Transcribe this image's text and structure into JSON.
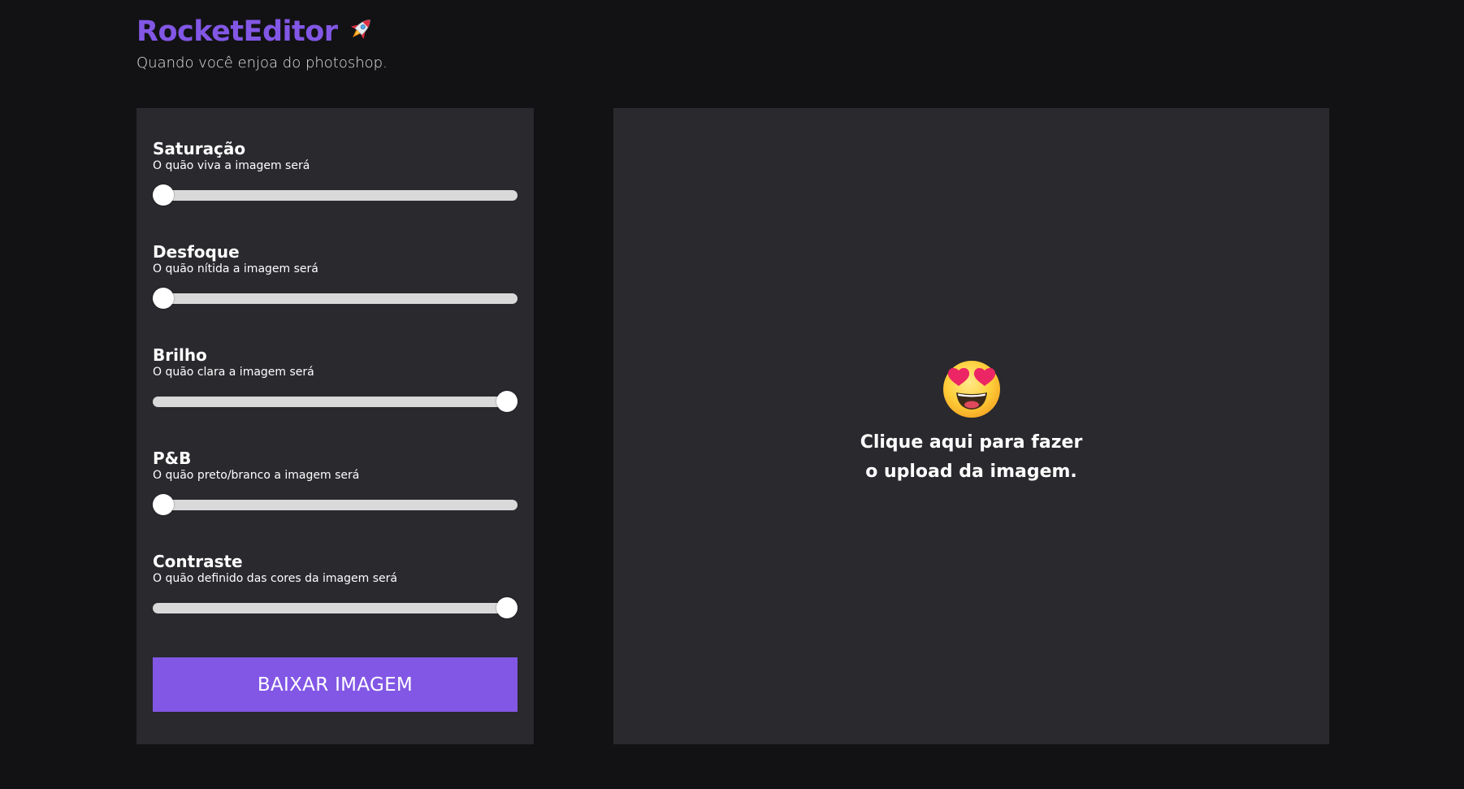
{
  "header": {
    "title": "RocketEditor",
    "subtitle": "Quando você enjoa do photoshop."
  },
  "controls": [
    {
      "key": "saturation",
      "label": "Saturação",
      "description": "O quão viva a imagem será",
      "value": 0
    },
    {
      "key": "blur",
      "label": "Desfoque",
      "description": "O quão nítida a imagem será",
      "value": 0
    },
    {
      "key": "brightness",
      "label": "Brilho",
      "description": "O quão clara a imagem será",
      "value": 1
    },
    {
      "key": "grayscale",
      "label": "P&B",
      "description": "O quão preto/branco a imagem será",
      "value": 0
    },
    {
      "key": "contrast",
      "label": "Contraste",
      "description": "O quão definido das cores da imagem será",
      "value": 1
    }
  ],
  "download_button": {
    "label": "BAIXAR IMAGEM"
  },
  "upload": {
    "text": "Clique aqui para fazer o upload da imagem.",
    "icon": "heart-eyes-emoji-icon"
  },
  "colors": {
    "accent": "#8257e5",
    "background": "#121214",
    "panel": "#29292e",
    "track": "#d9d9d9"
  }
}
